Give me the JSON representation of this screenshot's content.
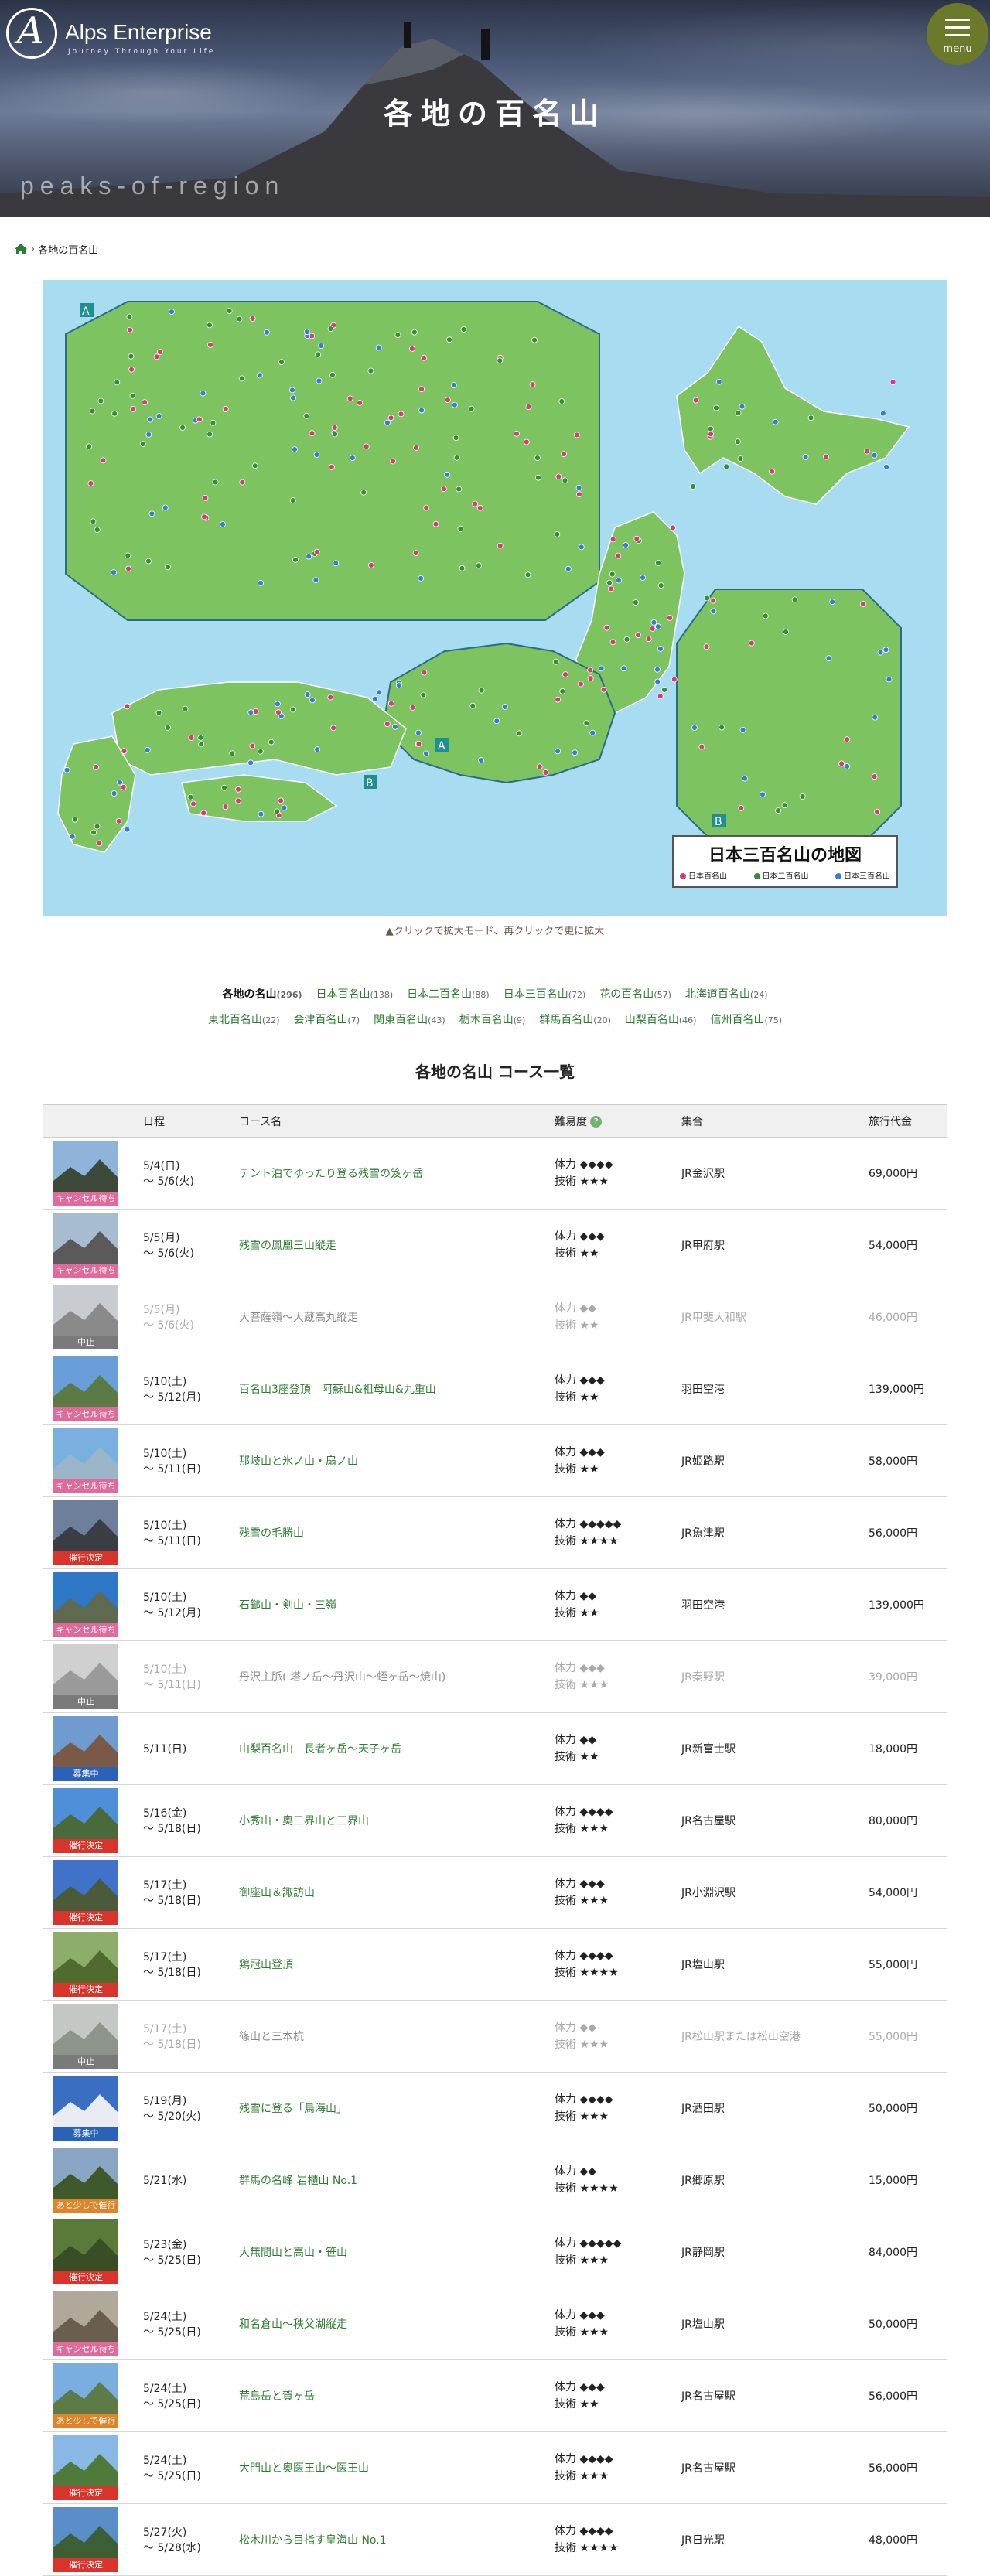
{
  "brand": {
    "name": "Alps Enterprise",
    "tagline": "Journey Through Your Life",
    "logo_letter": "A"
  },
  "menu": {
    "label": "menu"
  },
  "hero": {
    "title": "各地の百名山",
    "subtitle": "peaks-of-region"
  },
  "breadcrumb": {
    "current": "各地の百名山"
  },
  "map": {
    "title": "日本三百名山の地図",
    "legend": [
      {
        "label": "日本百名山",
        "color": "#d63a7a"
      },
      {
        "label": "日本二百名山",
        "color": "#3a8a3a"
      },
      {
        "label": "日本三百名山",
        "color": "#3a7ad6"
      }
    ],
    "caption": "▲クリックで拡大モード、再クリックで更に拡大"
  },
  "region_links": [
    {
      "label": "各地の名山",
      "count": "(296)",
      "current": true
    },
    {
      "label": "日本百名山",
      "count": "(138)"
    },
    {
      "label": "日本二百名山",
      "count": "(88)"
    },
    {
      "label": "日本三百名山",
      "count": "(72)"
    },
    {
      "label": "花の百名山",
      "count": "(57)"
    },
    {
      "label": "北海道百名山",
      "count": "(24)"
    },
    {
      "label": "東北百名山",
      "count": "(22)"
    },
    {
      "label": "会津百名山",
      "count": "(7)"
    },
    {
      "label": "関東百名山",
      "count": "(43)"
    },
    {
      "label": "栃木百名山",
      "count": "(9)"
    },
    {
      "label": "群馬百名山",
      "count": "(20)"
    },
    {
      "label": "山梨百名山",
      "count": "(46)"
    },
    {
      "label": "信州百名山",
      "count": "(75)"
    }
  ],
  "section": {
    "title": "各地の名山 コース一覧"
  },
  "table": {
    "headers": {
      "date": "日程",
      "name": "コース名",
      "difficulty": "難易度",
      "help": "?",
      "meeting": "集合",
      "price": "旅行代金"
    },
    "rows": [
      {
        "date1": "5/4(日)",
        "date2": "～ 5/6(火)",
        "name": "テント泊でゆったり登る残雪の笈ヶ岳",
        "stamina": "体力 ◆◆◆◆",
        "tech": "技術 ★★★",
        "meeting": "JR金沢駅",
        "price": "69,000円",
        "status": "キャンセル待ち",
        "badge": "#e06a9a",
        "stopped": false,
        "sky": "#8fb4da",
        "mtn": "#3d4a3a"
      },
      {
        "date1": "5/5(月)",
        "date2": "～ 5/6(火)",
        "name": "残雪の鳳凰三山縦走",
        "stamina": "体力 ◆◆◆",
        "tech": "技術 ★★",
        "meeting": "JR甲府駅",
        "price": "54,000円",
        "status": "キャンセル待ち",
        "badge": "#e06a9a",
        "stopped": false,
        "sky": "#a8bcd0",
        "mtn": "#5a5a5a"
      },
      {
        "date1": "5/5(月)",
        "date2": "～ 5/6(火)",
        "name": "大菩薩嶺～大蔵高丸縦走",
        "stamina": "体力 ◆◆",
        "tech": "技術 ★★",
        "meeting": "JR甲斐大和駅",
        "price": "46,000円",
        "status": "中止",
        "badge": "#7a7a7a",
        "stopped": true,
        "sky": "#c8ccd0",
        "mtn": "#8a8a8a"
      },
      {
        "date1": "5/10(土)",
        "date2": "～ 5/12(月)",
        "name": "百名山3座登頂　阿蘇山&祖母山&九重山",
        "stamina": "体力 ◆◆◆",
        "tech": "技術 ★★",
        "meeting": "羽田空港",
        "price": "139,000円",
        "status": "キャンセル待ち",
        "badge": "#e06a9a",
        "stopped": false,
        "sky": "#6a9ed8",
        "mtn": "#5b7a44"
      },
      {
        "date1": "5/10(土)",
        "date2": "～ 5/11(日)",
        "name": "那岐山と氷ノ山・扇ノ山",
        "stamina": "体力 ◆◆◆",
        "tech": "技術 ★★",
        "meeting": "JR姫路駅",
        "price": "58,000円",
        "status": "キャンセル待ち",
        "badge": "#e06a9a",
        "stopped": false,
        "sky": "#7ab0e0",
        "mtn": "#9ab4c8"
      },
      {
        "date1": "5/10(土)",
        "date2": "～ 5/11(日)",
        "name": "残雪の毛勝山",
        "stamina": "体力 ◆◆◆◆◆",
        "tech": "技術 ★★★★",
        "meeting": "JR魚津駅",
        "price": "56,000円",
        "status": "催行決定",
        "badge": "#d9342b",
        "stopped": false,
        "sky": "#6d7f9a",
        "mtn": "#3a3e44"
      },
      {
        "date1": "5/10(土)",
        "date2": "～ 5/12(月)",
        "name": "石鎚山・剣山・三嶺",
        "stamina": "体力 ◆◆",
        "tech": "技術 ★★",
        "meeting": "羽田空港",
        "price": "139,000円",
        "status": "キャンセル待ち",
        "badge": "#e06a9a",
        "stopped": false,
        "sky": "#2f78c8",
        "mtn": "#5e6a52"
      },
      {
        "date1": "5/10(土)",
        "date2": "～ 5/11(日)",
        "name": "丹沢主脈( 塔ノ岳～丹沢山～蛭ヶ岳～焼山)",
        "stamina": "体力 ◆◆◆",
        "tech": "技術 ★★★",
        "meeting": "JR秦野駅",
        "price": "39,000円",
        "status": "中止",
        "badge": "#7a7a7a",
        "stopped": true,
        "sky": "#d0d0d0",
        "mtn": "#9a9a9a"
      },
      {
        "date1": "5/11(日)",
        "date2": "",
        "name": "山梨百名山　長者ヶ岳～天子ヶ岳",
        "stamina": "体力 ◆◆",
        "tech": "技術 ★★",
        "meeting": "JR新富士駅",
        "price": "18,000円",
        "status": "募集中",
        "badge": "#2a62b8",
        "stopped": false,
        "sky": "#6f9bd0",
        "mtn": "#7a5a46"
      },
      {
        "date1": "5/16(金)",
        "date2": "～ 5/18(日)",
        "name": "小秀山・奥三界山と三界山",
        "stamina": "体力 ◆◆◆◆",
        "tech": "技術 ★★★",
        "meeting": "JR名古屋駅",
        "price": "80,000円",
        "status": "催行決定",
        "badge": "#d9342b",
        "stopped": false,
        "sky": "#4d8fd8",
        "mtn": "#4a6a3a"
      },
      {
        "date1": "5/17(土)",
        "date2": "～ 5/18(日)",
        "name": "御座山＆諏訪山",
        "stamina": "体力 ◆◆◆",
        "tech": "技術 ★★★",
        "meeting": "JR小淵沢駅",
        "price": "54,000円",
        "status": "催行決定",
        "badge": "#d9342b",
        "stopped": false,
        "sky": "#3f72c8",
        "mtn": "#4b5b3a"
      },
      {
        "date1": "5/17(土)",
        "date2": "～ 5/18(日)",
        "name": "鶏冠山登頂",
        "stamina": "体力 ◆◆◆◆",
        "tech": "技術 ★★★★",
        "meeting": "JR塩山駅",
        "price": "55,000円",
        "status": "催行決定",
        "badge": "#d9342b",
        "stopped": false,
        "sky": "#8cae6a",
        "mtn": "#4f6b2e"
      },
      {
        "date1": "5/17(土)",
        "date2": "～ 5/18(日)",
        "name": "篠山と三本杭",
        "stamina": "体力 ◆◆",
        "tech": "技術 ★★★",
        "meeting": "JR松山駅または松山空港",
        "price": "55,000円",
        "status": "中止",
        "badge": "#7a7a7a",
        "stopped": true,
        "sky": "#c4c8c4",
        "mtn": "#8c948c"
      },
      {
        "date1": "5/19(月)",
        "date2": "～ 5/20(火)",
        "name": "残雪に登る「鳥海山」",
        "stamina": "体力 ◆◆◆◆",
        "tech": "技術 ★★★",
        "meeting": "JR酒田駅",
        "price": "50,000円",
        "status": "募集中",
        "badge": "#2a62b8",
        "stopped": false,
        "sky": "#3a6ec0",
        "mtn": "#e8ecf0"
      },
      {
        "date1": "5/21(水)",
        "date2": "",
        "name": "群馬の名峰 岩櫃山 No.1",
        "stamina": "体力 ◆◆",
        "tech": "技術 ★★★★",
        "meeting": "JR郷原駅",
        "price": "15,000円",
        "status": "あと少しで催行",
        "badge": "#e0842a",
        "stopped": false,
        "sky": "#88a6c4",
        "mtn": "#3e5a2a"
      },
      {
        "date1": "5/23(金)",
        "date2": "～ 5/25(日)",
        "name": "大無間山と高山・笹山",
        "stamina": "体力 ◆◆◆◆◆",
        "tech": "技術 ★★★",
        "meeting": "JR静岡駅",
        "price": "84,000円",
        "status": "催行決定",
        "badge": "#d9342b",
        "stopped": false,
        "sky": "#5a7a3a",
        "mtn": "#3a4e26"
      },
      {
        "date1": "5/24(土)",
        "date2": "～ 5/25(日)",
        "name": "和名倉山～秩父湖縦走",
        "stamina": "体力 ◆◆◆",
        "tech": "技術 ★★★",
        "meeting": "JR塩山駅",
        "price": "50,000円",
        "status": "キャンセル待ち",
        "badge": "#e06a9a",
        "stopped": false,
        "sky": "#b0a898",
        "mtn": "#6a5e4e"
      },
      {
        "date1": "5/24(土)",
        "date2": "～ 5/25(日)",
        "name": "荒島岳と賀ヶ岳",
        "stamina": "体力 ◆◆◆",
        "tech": "技術 ★★",
        "meeting": "JR名古屋駅",
        "price": "56,000円",
        "status": "あと少しで催行",
        "badge": "#e0842a",
        "stopped": false,
        "sky": "#7aaee0",
        "mtn": "#5e7a46"
      },
      {
        "date1": "5/24(土)",
        "date2": "～ 5/25(日)",
        "name": "大門山と奥医王山～医王山",
        "stamina": "体力 ◆◆◆◆",
        "tech": "技術 ★★★",
        "meeting": "JR名古屋駅",
        "price": "56,000円",
        "status": "催行決定",
        "badge": "#d9342b",
        "stopped": false,
        "sky": "#8ab8e4",
        "mtn": "#4e7a3a"
      },
      {
        "date1": "5/27(火)",
        "date2": "～ 5/28(水)",
        "name": "松木川から目指す皇海山 No.1",
        "stamina": "体力 ◆◆◆◆",
        "tech": "技術 ★★★★",
        "meeting": "JR日光駅",
        "price": "48,000円",
        "status": "催行決定",
        "badge": "#d9342b",
        "stopped": false,
        "sky": "#5a8ec8",
        "mtn": "#3e5e34"
      }
    ]
  }
}
